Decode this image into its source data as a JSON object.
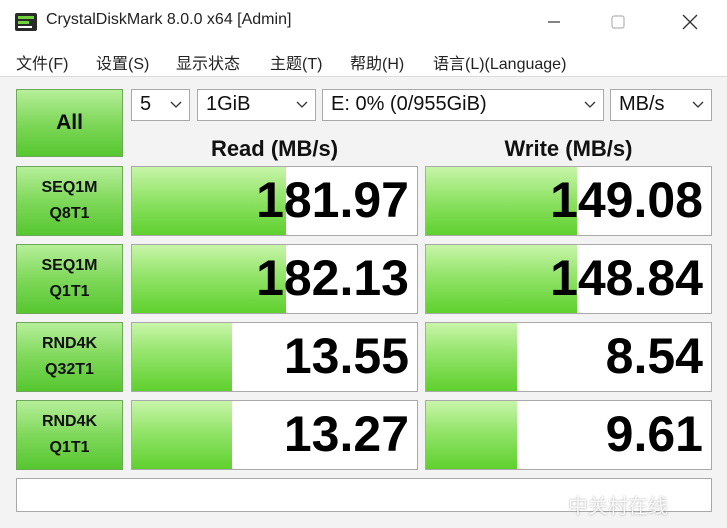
{
  "window": {
    "title": "CrystalDiskMark 8.0.0 x64 [Admin]"
  },
  "menu": [
    "文件(F)",
    "设置(S)",
    "显示状态",
    "主题(T)",
    "帮助(H)",
    "语言(L)(Language)"
  ],
  "controls": {
    "all_label": "All",
    "count": "5",
    "size": "1GiB",
    "drive": "E: 0% (0/955GiB)",
    "unit": "MB/s"
  },
  "headers": {
    "read": "Read (MB/s)",
    "write": "Write (MB/s)"
  },
  "tests": [
    {
      "line1": "SEQ1M",
      "line2": "Q8T1",
      "read": "181.97",
      "write": "149.08",
      "read_fill": 0.54,
      "write_fill": 0.53
    },
    {
      "line1": "SEQ1M",
      "line2": "Q1T1",
      "read": "182.13",
      "write": "148.84",
      "read_fill": 0.54,
      "write_fill": 0.53
    },
    {
      "line1": "RND4K",
      "line2": "Q32T1",
      "read": "13.55",
      "write": "8.54",
      "read_fill": 0.35,
      "write_fill": 0.32
    },
    {
      "line1": "RND4K",
      "line2": "Q1T1",
      "read": "13.27",
      "write": "9.61",
      "read_fill": 0.35,
      "write_fill": 0.32
    }
  ],
  "status_text": "",
  "watermark": "中关村在线",
  "colors": {
    "bar_green": "#5fd02e",
    "button_green": "#7fd85a"
  }
}
